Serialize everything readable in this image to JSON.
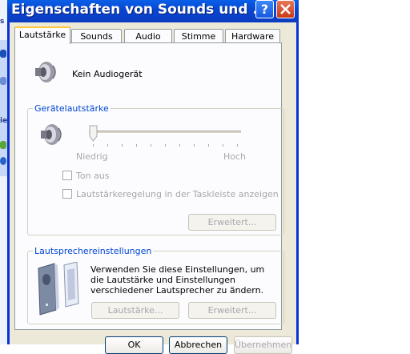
{
  "window": {
    "title": "Eigenschaften von Sounds und ...",
    "help_glyph": "?",
    "colors": {
      "titlebar": "#0845d0",
      "client": "#ece9d8",
      "group_title": "#0046d5",
      "disabled_text": "#a7a6aa"
    }
  },
  "background": {
    "left_labels": [
      "s",
      "ie"
    ]
  },
  "tabs": [
    {
      "label": "Lautstärke",
      "active": true
    },
    {
      "label": "Sounds",
      "active": false
    },
    {
      "label": "Audio",
      "active": false
    },
    {
      "label": "Stimme",
      "active": false
    },
    {
      "label": "Hardware",
      "active": false
    }
  ],
  "device": {
    "text": "Kein Audiogerät",
    "icon": "speaker-icon"
  },
  "volume_group": {
    "title": "Gerätelautstärke",
    "low_label": "Niedrig",
    "high_label": "Hoch",
    "level": 0,
    "mute_label": "Ton aus",
    "mute_checked": false,
    "taskbar_label": "Lautstärkeregelung in der Taskleiste anzeigen",
    "taskbar_checked": false,
    "advanced_label": "Erweitert..."
  },
  "speaker_group": {
    "title": "Lautsprechereinstellungen",
    "description": "Verwenden Sie diese Einstellungen, um die Lautstärke und Einstellungen verschiedener Lautsprecher zu ändern.",
    "volume_button": "Lautstärke...",
    "advanced_button": "Erweitert..."
  },
  "footer": {
    "ok": "OK",
    "cancel": "Abbrechen",
    "apply": "Übernehmen"
  }
}
